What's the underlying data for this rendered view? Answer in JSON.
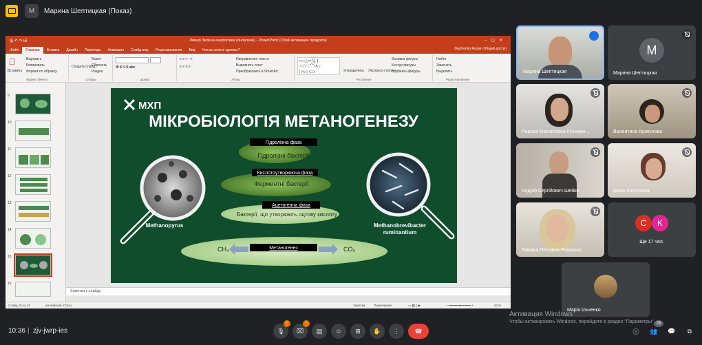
{
  "meet": {
    "presenter_label": "Марина Шептицкая (Показ)",
    "presenter_avatar_letter": "M",
    "time": "10:36",
    "separator": "|",
    "meeting_code": "zjv-jwrp-ies",
    "participants_count": "26",
    "chat_badge": "",
    "controls": {
      "mic_badge": "!",
      "cam_badge": "!"
    }
  },
  "participants": [
    {
      "name": "Марина Шептицкая",
      "type": "video",
      "speaking": true
    },
    {
      "name": "Марина Шептицкая",
      "type": "avatar",
      "letter": "M",
      "color": "#5f6368"
    },
    {
      "name": "Лариса Михайлівна Кузьмен...",
      "type": "video"
    },
    {
      "name": "Валентина Крикунова",
      "type": "video"
    },
    {
      "name": "Андрій Сергійович Шейко",
      "type": "video"
    },
    {
      "name": "Ірина Короткова",
      "type": "video"
    },
    {
      "name": "Тамара Петрівна Ромашко",
      "type": "video"
    },
    {
      "name": "Ще 17 чел.",
      "type": "more",
      "letters": [
        "C",
        "K"
      ],
      "colors": [
        "#d93025",
        "#e52592"
      ]
    },
    {
      "name": "Марія Ільченко",
      "type": "photo"
    }
  ],
  "windows_watermark": {
    "title": "Активация Windows",
    "subtitle": "Чтобы активировать Windows, перейдите в раздел \"Параметры\"."
  },
  "ppt": {
    "window_title": "Лекція Зелена енергетика (оновлене) - PowerPoint (Сбой активации продукта)",
    "user": "Diachenko Ruslan",
    "share_label": "Общий доступ",
    "tabs": [
      "Файл",
      "Главная",
      "Вставка",
      "Дизайн",
      "Переходы",
      "Анимация",
      "Слайд-шоу",
      "Рецензирование",
      "Вид",
      "Что вы хотите сделать?"
    ],
    "ribbon": {
      "clipboard": {
        "paste": "Вставить",
        "cut": "Вырезать",
        "copy": "Копировать",
        "format": "Формат по образцу",
        "label": "Буфер обмена"
      },
      "slides": {
        "new": "Создать слайд",
        "layout": "Макет",
        "reset": "Сбросить",
        "section": "Раздел",
        "label": "Слайды"
      },
      "font": {
        "label": "Шрифт"
      },
      "paragraph": {
        "direction": "Направление текста",
        "align": "Выровнять текст",
        "smartart": "Преобразовать в SmartArt",
        "label": "Абзац"
      },
      "drawing": {
        "arrange": "Упорядочить",
        "styles": "Экспресс-стили",
        "fill": "Заливка фигуры",
        "outline": "Контур фигуры",
        "effects": "Эффекты фигуры",
        "label": "Рисование"
      },
      "editing": {
        "find": "Найти",
        "replace": "Заменить",
        "select": "Выделить",
        "label": "Редактирование"
      }
    },
    "thumb_numbers": [
      "9",
      "10",
      "11",
      "12",
      "13",
      "14",
      "15",
      "16"
    ],
    "notes_placeholder": "Заметки к слайду",
    "status": {
      "slide": "Слайд 15 из 23",
      "lang": "английский (США)",
      "notes": "Заметки",
      "comments": "Примечания",
      "zoom": "93 %"
    }
  },
  "slide": {
    "logo": "МХП",
    "title": "МІКРОБІОЛОГІЯ МЕТАНОГЕНЕЗУ",
    "phases": [
      {
        "phase": "Гідролізна фаза",
        "bacteria": "Гідролізні бактерії"
      },
      {
        "phase": "Кислотоутворююча фаза",
        "bacteria": "Ферментні бактерії"
      },
      {
        "phase": "Ацетогенна фаза",
        "bacteria": "Бактерії, що утворюють оцтову кислоту"
      },
      {
        "phase": "Метаногенез",
        "bacteria": ""
      }
    ],
    "ch4": "CH₄",
    "co2": "CO₂",
    "left_organism": "Methanopyrus",
    "right_organism_line1": "Methanobrevibacter",
    "right_organism_line2": "ruminantium"
  }
}
